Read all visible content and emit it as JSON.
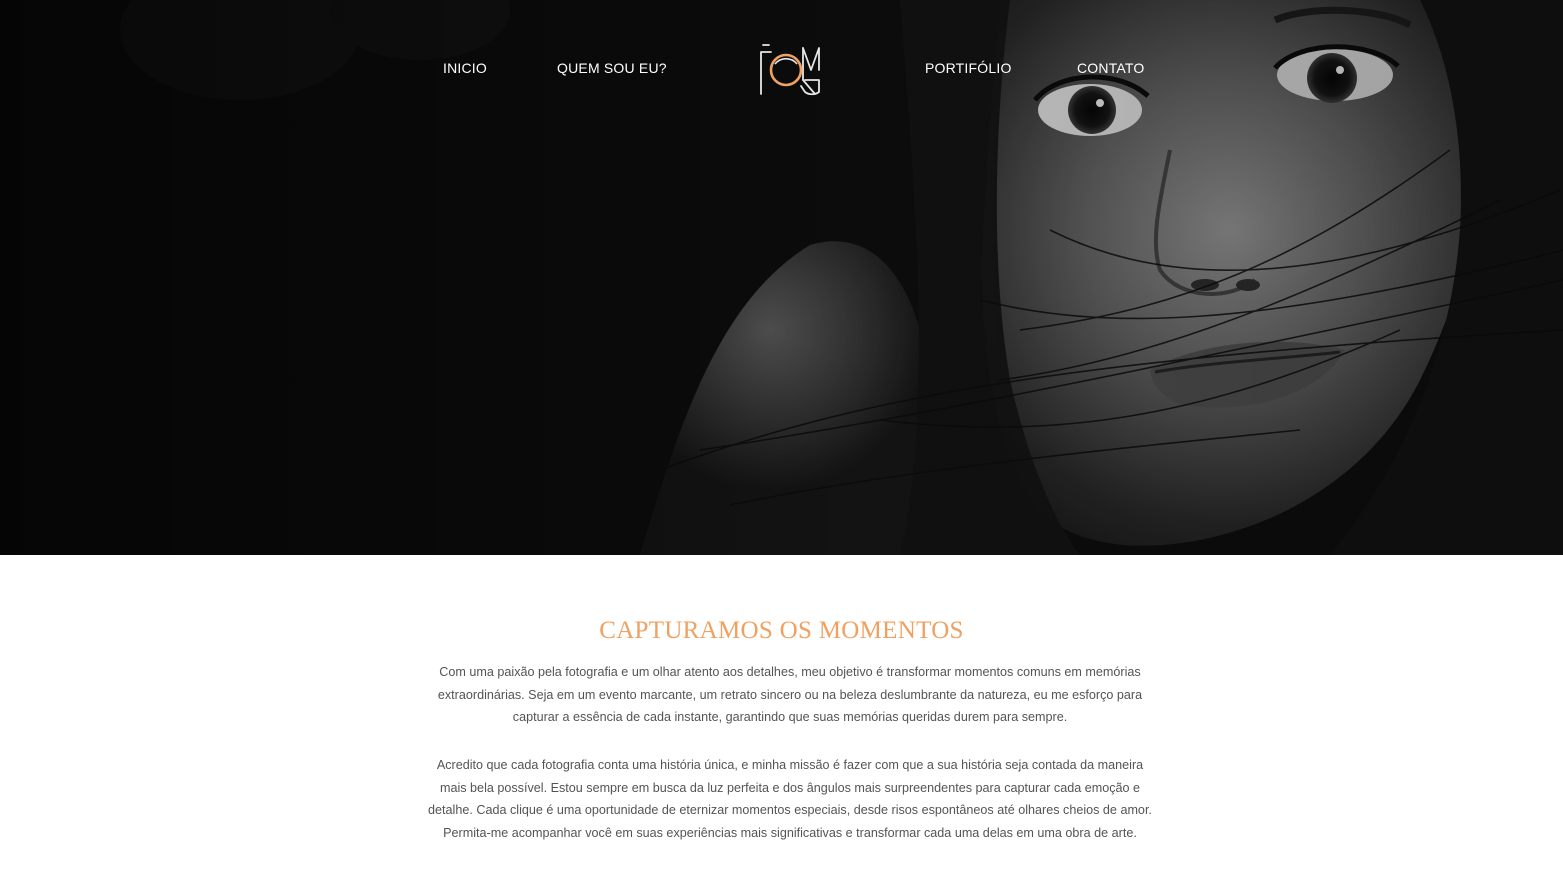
{
  "nav": {
    "items": [
      {
        "label": "INICIO"
      },
      {
        "label": "QUEM SOU EU?"
      },
      {
        "label": "PORTIFÓLIO"
      },
      {
        "label": "CONTATO"
      }
    ],
    "logo_icon": "camera-monogram-logo"
  },
  "hero": {
    "image": "black-and-white portrait of a woman with hair across her face"
  },
  "about": {
    "title": "CAPTURAMOS OS MOMENTOS",
    "paragraphs": [
      "Com uma paixão pela fotografia e um olhar atento aos detalhes, meu objetivo é transformar momentos comuns em memórias extraordinárias. Seja em um evento marcante, um retrato sincero ou na beleza deslumbrante da natureza, eu me esforço para capturar a essência de cada instante, garantindo que suas memórias queridas durem para sempre.",
      "Acredito que cada fotografia conta uma história única, e minha missão é fazer com que a sua história seja contada da maneira mais bela possível. Estou sempre em busca da luz perfeita e dos ângulos mais surpreendentes para capturar cada emoção e detalhe. Cada clique é uma oportunidade de eternizar momentos especiais, desde risos espontâneos até olhares cheios de amor. Permita-me acompanhar você em suas experiências mais significativas e transformar cada uma delas em uma obra de arte."
    ]
  },
  "colors": {
    "accent": "#f0a161",
    "body_text": "#545454",
    "hero_background": "#0b0b0b",
    "nav_text": "#ffffff"
  }
}
